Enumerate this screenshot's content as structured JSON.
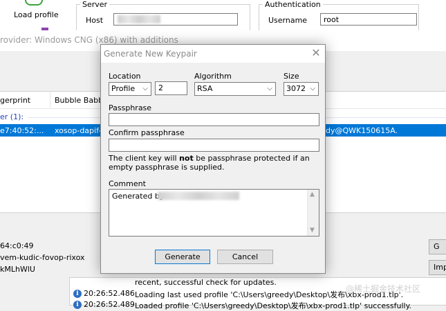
{
  "toolbar": {
    "load_profile_label": "Load profile"
  },
  "server": {
    "group_title": "Server",
    "host_label": "Host",
    "host_value": ""
  },
  "authentication": {
    "group_title": "Authentication",
    "username_label": "Username",
    "username_value": "root"
  },
  "provider_text": "rovider: Windows CNG (x86) with additions",
  "key_list": {
    "columns": [
      "gerprint",
      "Bubble Babble"
    ],
    "group_label": "er (1):",
    "selected_row": {
      "fingerprint": "e7:40:52:...",
      "bubble": "xosop-dapif-k",
      "comment": "dy@QWK150615A."
    }
  },
  "details": {
    "line1": "64:c0:49",
    "line2": "vem-kudic-fovop-rixox",
    "line3": "kMLhWlU"
  },
  "side_buttons": {
    "btn1": "G",
    "btn2": "Imp"
  },
  "log": {
    "line0": "recent, successful check for updates.",
    "line1_time": "20:26:52.486",
    "line1_text": "Loading last used profile 'C:\\Users\\greedy\\Desktop\\发布\\xbx-prod1.tlp'.",
    "line2_time": "20:26:52.489",
    "line2_text": "Loaded profile 'C:\\Users\\greedy\\Desktop\\发布\\xbx-prod1.tlp' successfully."
  },
  "watermark": "@稀土掘金技术社区",
  "dialog": {
    "title": "Generate New Keypair",
    "location_label": "Location",
    "location_value": "Profile",
    "location_number": "2",
    "algorithm_label": "Algorithm",
    "algorithm_value": "RSA",
    "size_label": "Size",
    "size_value": "3072",
    "passphrase_label": "Passphrase",
    "passphrase_value": "",
    "confirm_label": "Confirm passphrase",
    "confirm_value": "",
    "note_pre": "The client key will ",
    "note_bold": "not",
    "note_post": " be passphrase protected if an empty passphrase is supplied.",
    "comment_label": "Comment",
    "comment_value": "Generated by",
    "generate_button": "Generate",
    "cancel_button": "Cancel"
  },
  "icons": {
    "close": "close-icon",
    "chevron": "chevron-down-icon",
    "info": "info-icon",
    "load_profile": "load-profile-icon"
  }
}
